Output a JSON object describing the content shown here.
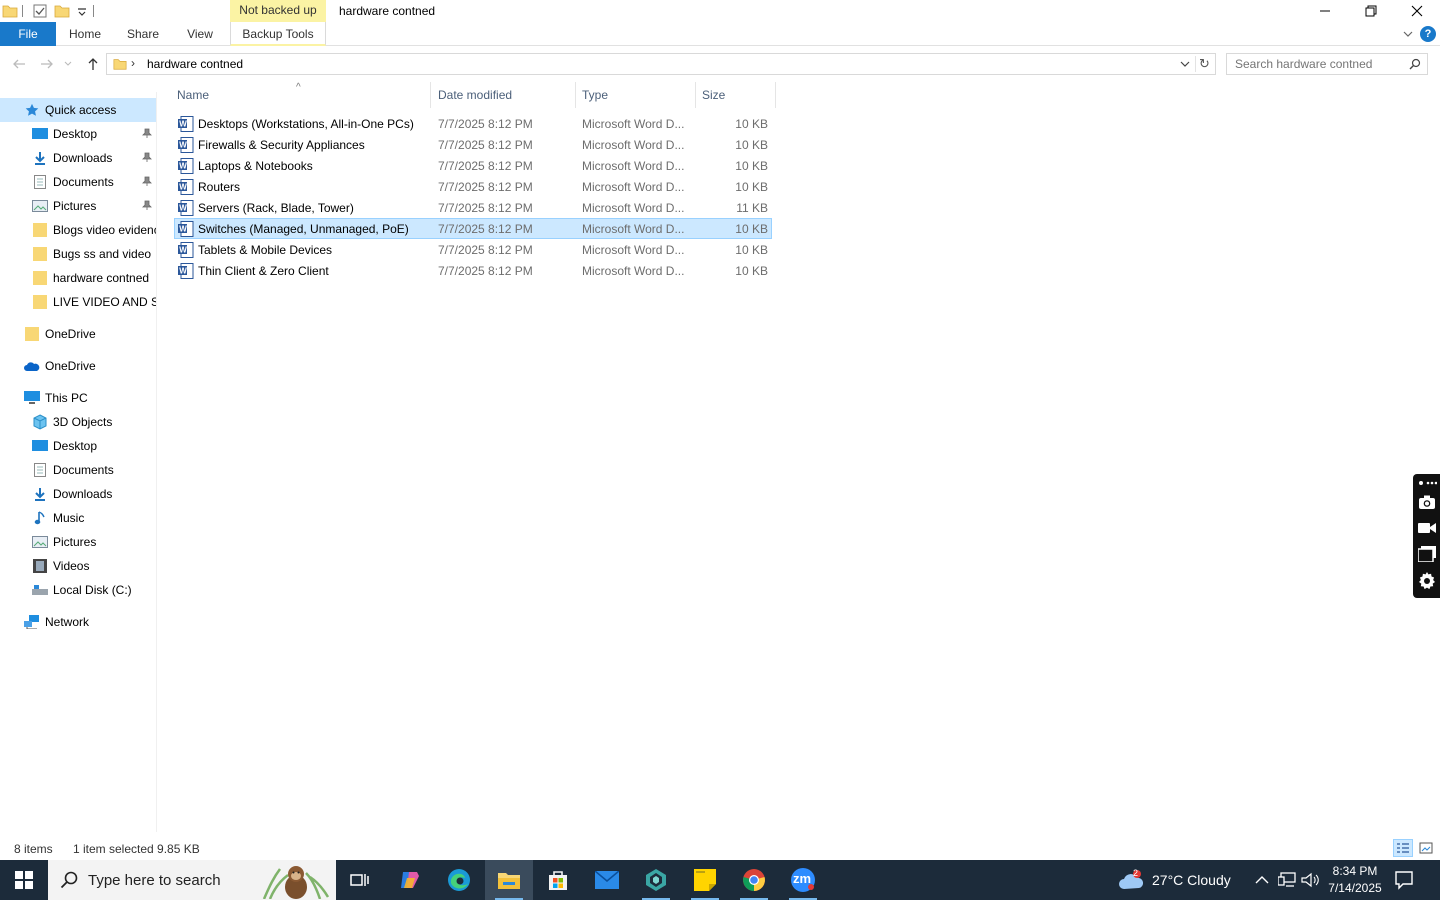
{
  "window": {
    "context_tab_label": "Not backed up",
    "title": "hardware contned"
  },
  "ribbon": {
    "tabs": [
      "File",
      "Home",
      "Share",
      "View",
      "Backup Tools"
    ]
  },
  "address": {
    "path": "hardware contned",
    "search_placeholder": "Search hardware contned"
  },
  "sidebar": {
    "quick_access": "Quick access",
    "quick_items": [
      "Desktop",
      "Downloads",
      "Documents",
      "Pictures",
      "Blogs video evidenc",
      "Bugs ss and  video",
      "hardware contned",
      "LIVE VIDEO AND SS"
    ],
    "onedrive_folder": "OneDrive",
    "onedrive_cloud": "OneDrive",
    "this_pc": "This PC",
    "pc_items": [
      "3D Objects",
      "Desktop",
      "Documents",
      "Downloads",
      "Music",
      "Pictures",
      "Videos",
      "Local Disk (C:)"
    ],
    "network": "Network"
  },
  "columns": {
    "name": "Name",
    "date": "Date modified",
    "type": "Type",
    "size": "Size"
  },
  "files": [
    {
      "name": "Desktops (Workstations, All-in-One PCs)",
      "date": "7/7/2025 8:12 PM",
      "type": "Microsoft Word D...",
      "size": "10 KB"
    },
    {
      "name": "Firewalls & Security Appliances",
      "date": "7/7/2025 8:12 PM",
      "type": "Microsoft Word D...",
      "size": "10 KB"
    },
    {
      "name": "Laptops & Notebooks",
      "date": "7/7/2025 8:12 PM",
      "type": "Microsoft Word D...",
      "size": "10 KB"
    },
    {
      "name": "Routers",
      "date": "7/7/2025 8:12 PM",
      "type": "Microsoft Word D...",
      "size": "10 KB"
    },
    {
      "name": "Servers (Rack, Blade, Tower)",
      "date": "7/7/2025 8:12 PM",
      "type": "Microsoft Word D...",
      "size": "11 KB"
    },
    {
      "name": "Switches (Managed, Unmanaged, PoE)",
      "date": "7/7/2025 8:12 PM",
      "type": "Microsoft Word D...",
      "size": "10 KB",
      "selected": true
    },
    {
      "name": "Tablets & Mobile Devices",
      "date": "7/7/2025 8:12 PM",
      "type": "Microsoft Word D...",
      "size": "10 KB"
    },
    {
      "name": "Thin Client & Zero Client",
      "date": "7/7/2025 8:12 PM",
      "type": "Microsoft Word D...",
      "size": "10 KB"
    }
  ],
  "status": {
    "count": "8 items",
    "selected": "1 item selected  9.85 KB"
  },
  "taskbar": {
    "search_text": "Type here to search",
    "weather": "27°C  Cloudy",
    "weather_badge": "2",
    "time": "8:34 PM",
    "date": "7/14/2025",
    "zoom_label": "zm"
  },
  "colors": {
    "accent": "#1979ca",
    "selection": "#cce8ff",
    "selection_border": "#99d1ff",
    "context_tab": "#fbf3a4",
    "taskbar": "#1c2b3a"
  }
}
